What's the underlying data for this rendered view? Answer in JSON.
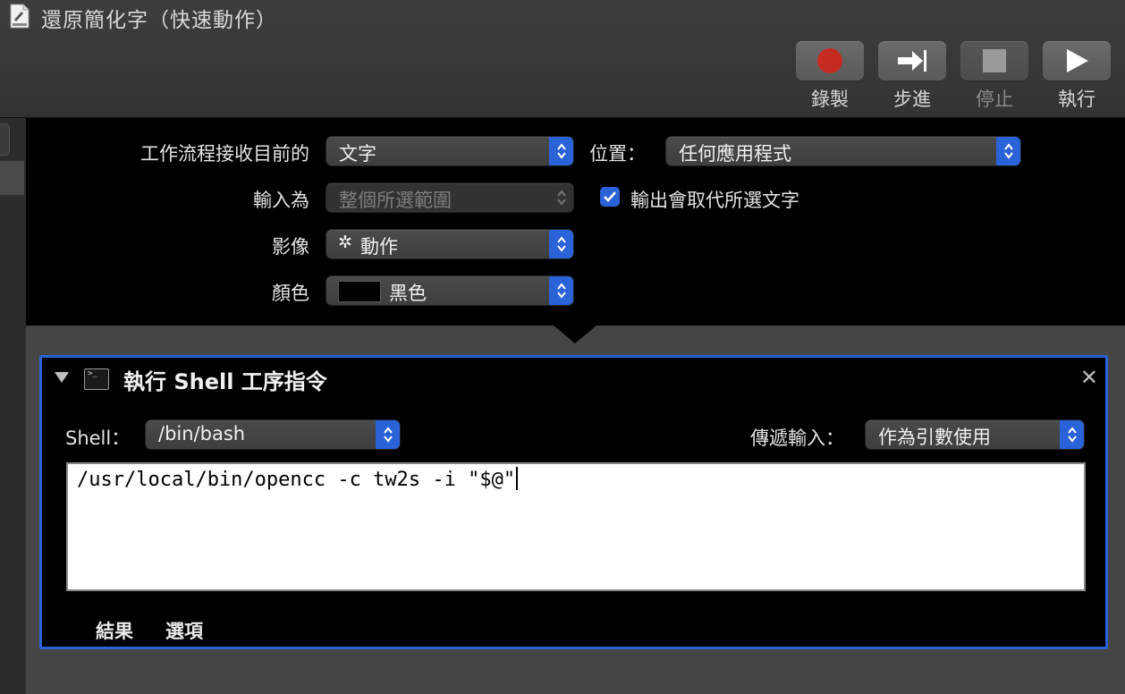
{
  "window": {
    "title": "還原簡化字（快速動作）"
  },
  "toolbar": {
    "record_label": "錄製",
    "step_label": "步進",
    "stop_label": "停止",
    "run_label": "執行"
  },
  "workflow": {
    "receives_label": "工作流程接收目前的",
    "receives_value": "文字",
    "location_label": "位置：",
    "location_value": "任何應用程式",
    "input_label": "輸入為",
    "input_value": "整個所選範圍",
    "output_replaces_label": "輸出會取代所選文字",
    "output_replaces_checked": true,
    "image_label": "影像",
    "image_value": "動作",
    "color_label": "顏色",
    "color_value": "黑色",
    "color_swatch": "#000000"
  },
  "action": {
    "title": "執行 Shell 工序指令",
    "shell_label": "Shell：",
    "shell_value": "/bin/bash",
    "pass_input_label": "傳遞輸入：",
    "pass_input_value": "作為引數使用",
    "script": "/usr/local/bin/opencc -c tw2s -i \"$@\"",
    "results_label": "結果",
    "options_label": "選項"
  },
  "colors": {
    "accent": "#2a62d8",
    "record": "#c62b22"
  }
}
